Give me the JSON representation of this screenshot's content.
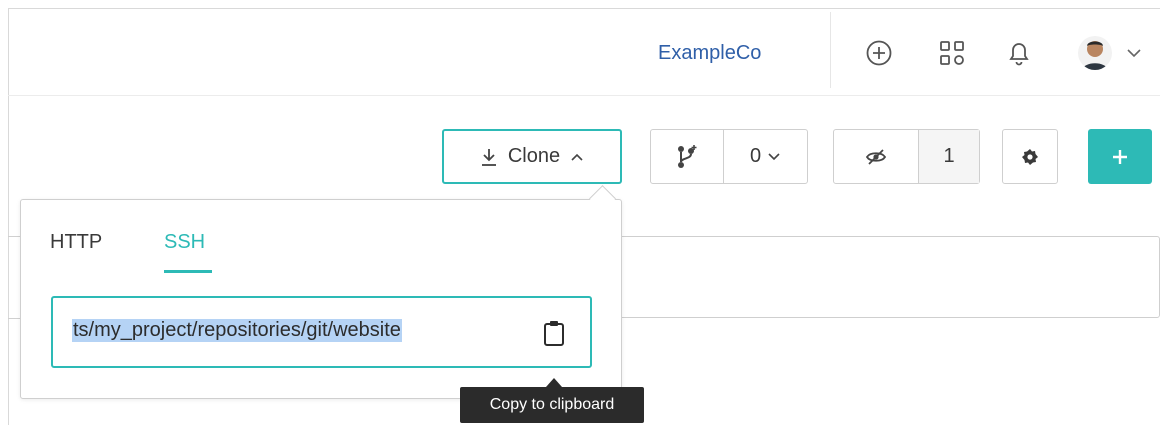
{
  "header": {
    "org_name": "ExampleCo",
    "icons": [
      "plus-circle-icon",
      "apps-grid-icon",
      "bell-icon",
      "avatar",
      "chevron-down-icon"
    ]
  },
  "toolbar": {
    "clone_label": "Clone",
    "branch_count": "0",
    "watch_count": "1"
  },
  "clone_popover": {
    "tabs": [
      {
        "label": "HTTP",
        "selected": false
      },
      {
        "label": "SSH",
        "selected": true
      }
    ],
    "url_value": "ts/my_project/repositories/git/website",
    "copy_tooltip": "Copy to clipboard"
  },
  "colors": {
    "accent": "#2dbab6",
    "link": "#2f5fa8",
    "tooltip_bg": "#2b2b2b",
    "selection": "#b5d3f5"
  }
}
